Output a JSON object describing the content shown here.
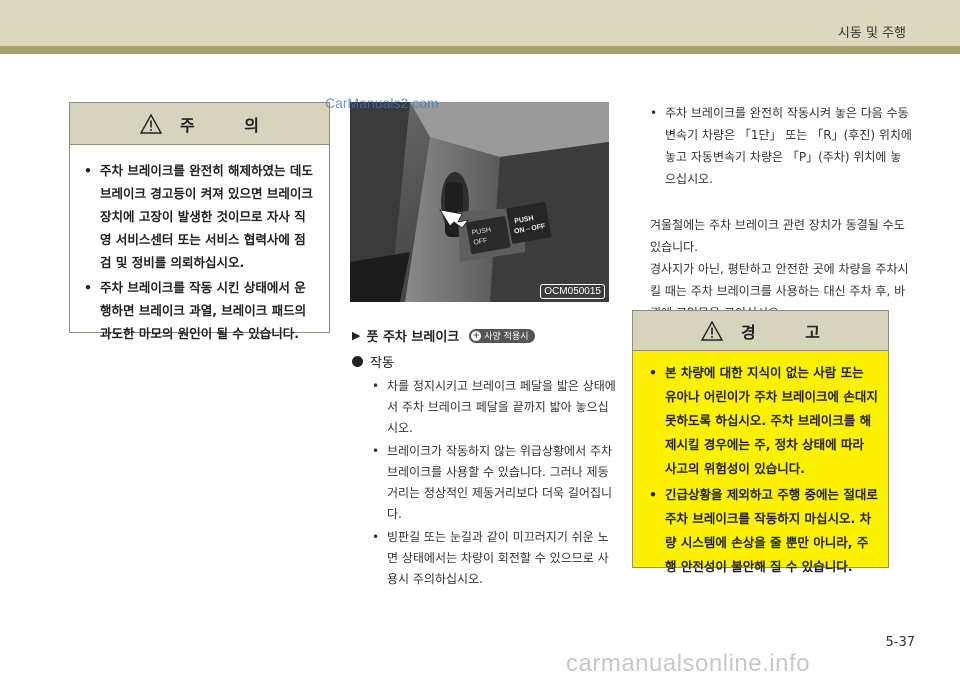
{
  "header": {
    "title": "시동 및 주행"
  },
  "watermark_top": "CarManuals2.com",
  "watermark_bottom": "carmanualsonline.info",
  "caution": {
    "title": "주 의",
    "items": [
      "주차 브레이크를 완전히 해제하였는 데도 브레이크 경고등이 켜져 있으면 브레이크 장치에 고장이 발생한 것이므로 자사 직영 서비스센터 또는 서비스 협력사에 점검 및 정비를 의뢰하십시오.",
      "주차 브레이크를 작동 시킨 상태에서 운행하면 브레이크 과열, 브레이크 패드의 과도한 마모의 원인이 될 수 있습니다."
    ]
  },
  "photo": {
    "code": "OCM050015",
    "pedal_label_1": "PUSH",
    "pedal_label_2": "ON⇔OFF",
    "pedal_label_3": "PUSH",
    "pedal_label_4": "OFF"
  },
  "section": {
    "arrow": "▶",
    "title": "풋 주차 브레이크",
    "badge": "사양 적용시",
    "sub_heading": "작동",
    "items": [
      "차를 정지시키고 브레이크 페달을 밟은 상태에서 주차 브레이크 페달을 끝까지 밟아 놓으십시오.",
      "브레이크가 작동하지 않는 위급상황에서 주차 브레이크를 사용할 수 있습니다. 그러나 제동거리는 정상적인 제동거리보다 더욱 길어집니다.",
      "빙판길 또는 눈길과 같이 미끄러지기 쉬운 노면 상태에서는 차량이 회전할 수 있으므로 사용시 주의하십시오."
    ]
  },
  "right": {
    "items": [
      "주차 브레이크를 완전히 작동시켜 놓은 다음 수동변속기 차량은 「1단」 또는 「R」(후진) 위치에 놓고 자동변속기 차량은 「P」(주차) 위치에 놓으십시오."
    ],
    "para1": "겨울철에는 주차 브레이크 관련 장치가 동결될 수도 있습니다.",
    "para2": "경사지가 아닌, 평탄하고 안전한 곳에 차량을 주차시킬 때는 주차 브레이크를 사용하는 대신 주차 후, 바퀴에 고임목을 고이십시오."
  },
  "warning": {
    "title": "경 고",
    "items": [
      "본 차량에 대한 지식이 없는 사람 또는 유아나 어린이가 주차 브레이크에 손대지 못하도록 하십시오. 주차 브레이크를 해제시킬 경우에는 주, 정차 상태에 따라 사고의 위험성이 있습니다.",
      "긴급상황을 제외하고 주행 중에는 절대로 주차 브레이크를 작동하지 마십시오. 차량 시스템에 손상을 줄 뿐만 아니라, 주행 안전성이 불안해 질 수 있습니다."
    ]
  },
  "page_number": "5-37",
  "colors": {
    "header_band": "#ddd9bf",
    "header_stripe": "#a9a36b",
    "box_head": "#d7d4bd",
    "warning_fill": "#fcf200",
    "watermark_blue": "#3f74c9"
  },
  "bullet": "•"
}
